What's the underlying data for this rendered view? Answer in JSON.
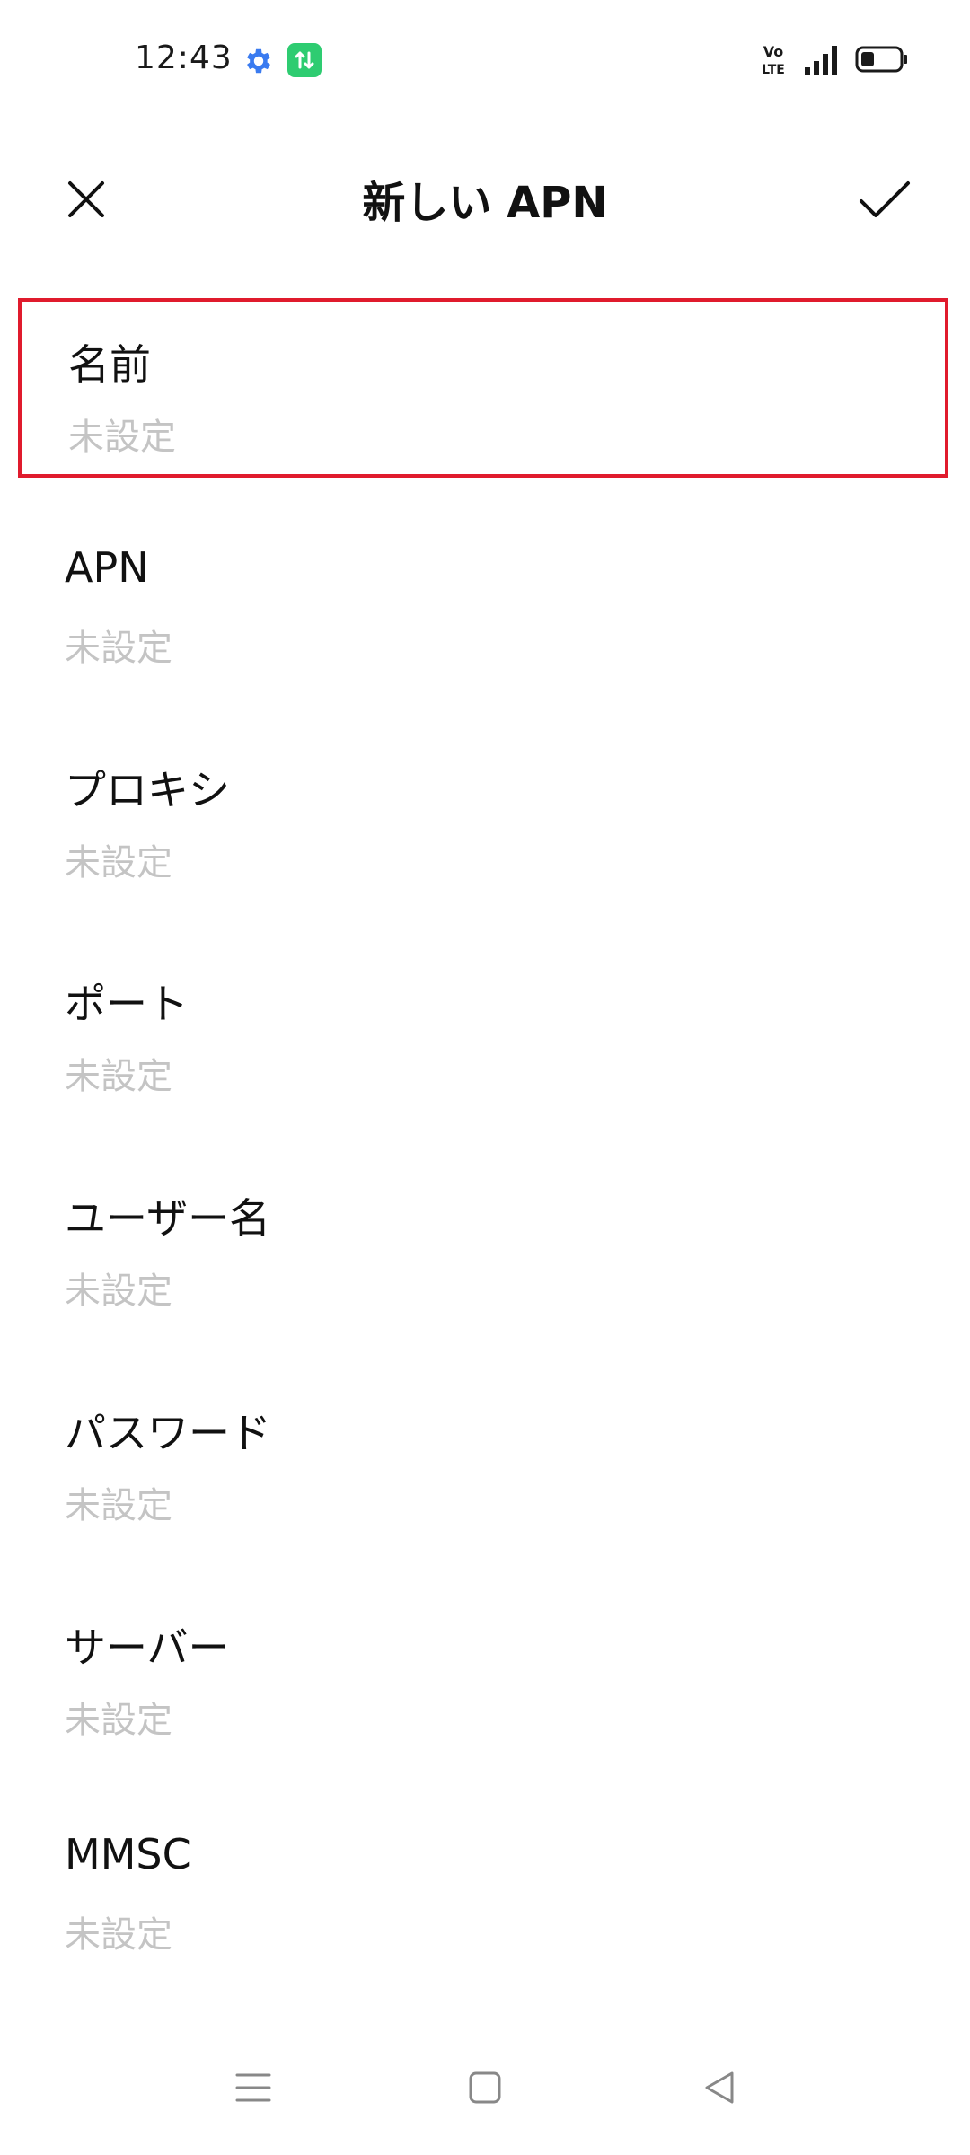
{
  "status_bar": {
    "time": "12:43",
    "icons": [
      "settings-gear-icon",
      "data-transfer-icon",
      "volte-icon",
      "signal-icon",
      "battery-icon"
    ],
    "volte_text_top": "Vo",
    "volte_text_bottom": "LTE",
    "battery_level": 0.35
  },
  "header": {
    "title": "新しい APN",
    "close_icon": "close-icon",
    "confirm_icon": "check-icon"
  },
  "fields": [
    {
      "label": "名前",
      "value": "未設定"
    },
    {
      "label": "APN",
      "value": "未設定"
    },
    {
      "label": "プロキシ",
      "value": "未設定"
    },
    {
      "label": "ポート",
      "value": "未設定"
    },
    {
      "label": "ユーザー名",
      "value": "未設定"
    },
    {
      "label": "パスワード",
      "value": "未設定"
    },
    {
      "label": "サーバー",
      "value": "未設定"
    },
    {
      "label": "MMSC",
      "value": "未設定"
    }
  ],
  "highlight_color": "#e01b2d",
  "accent_colors": {
    "gear": "#3a7bf0",
    "data": "#2ecc71"
  },
  "nav_bar": {
    "icons": [
      "menu-icon",
      "home-icon",
      "back-icon"
    ]
  }
}
